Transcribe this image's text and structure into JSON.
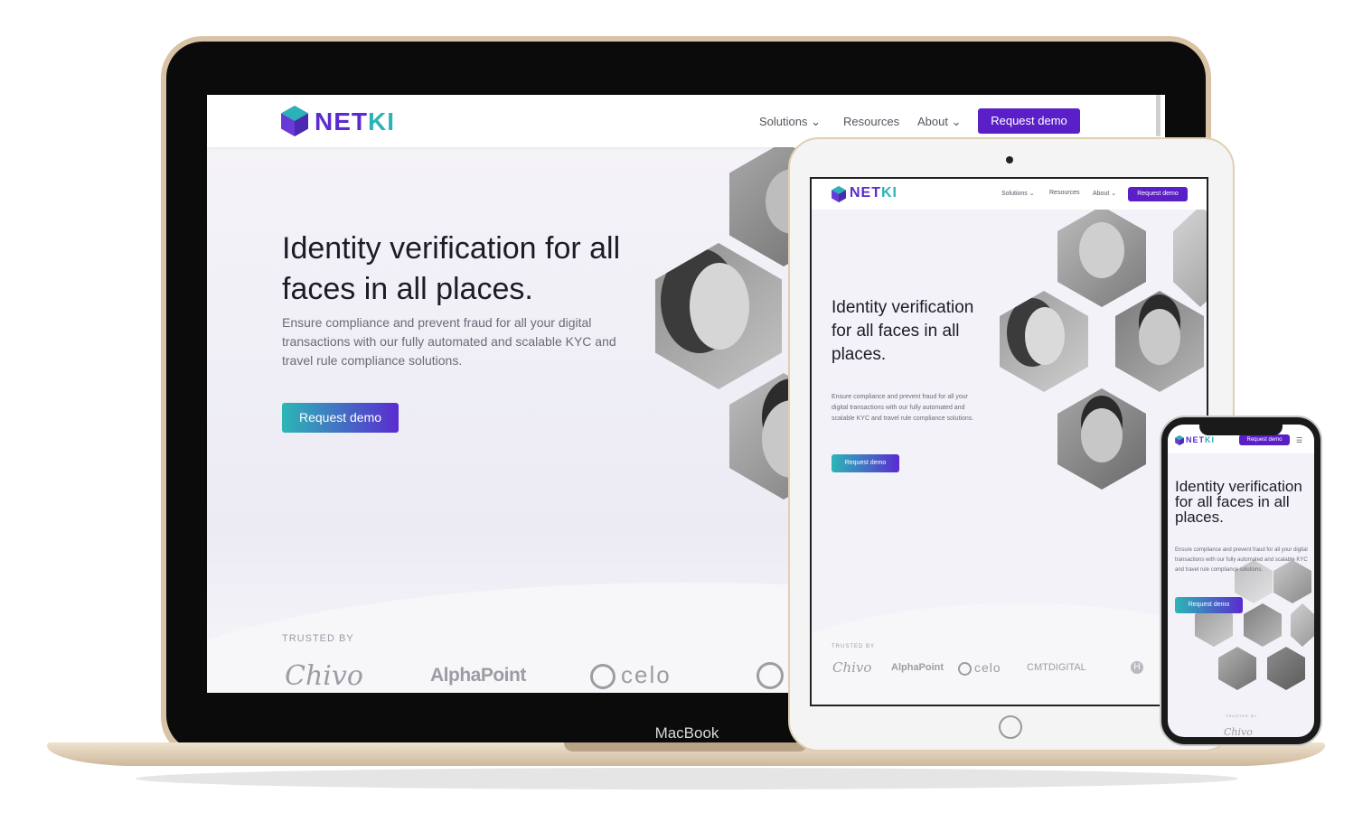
{
  "site": {
    "logo": {
      "net": "NET",
      "ki": "KI"
    },
    "nav": {
      "solutions": "Solutions",
      "resources": "Resources",
      "about": "About",
      "request_demo": "Request demo"
    },
    "hero": {
      "headline": "Identity verification for all faces in all places.",
      "subtext": "Ensure compliance and prevent fraud for all your digital transactions with our fully automated and scalable KYC and travel rule compliance solutions.",
      "cta": "Request demo"
    },
    "trusted_by": "TRUSTED BY",
    "brands": [
      "Chivo",
      "AlphaPoint",
      "celo",
      "CMTDIGITAL",
      "H"
    ]
  },
  "devices": {
    "macbook_label": "MacBook"
  },
  "colors": {
    "brand_purple": "#5a1fc7",
    "brand_teal": "#2ab3b7",
    "macbook_gold": "#d9c3a6"
  },
  "icons": {
    "chevron": "chevron-down-icon",
    "menu": "hamburger-menu-icon",
    "logo": "netki-hexagon-logo-icon"
  }
}
